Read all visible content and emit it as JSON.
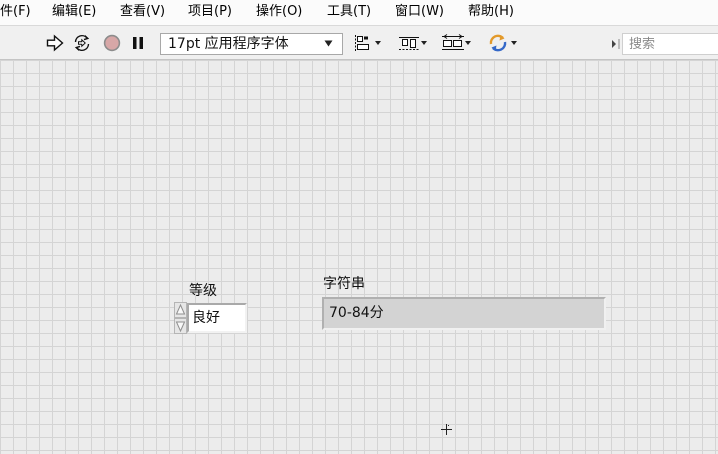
{
  "window": {
    "menu": [
      "件(F)",
      "编辑(E)",
      "查看(V)",
      "项目(P)",
      "操作(O)",
      "工具(T)",
      "窗口(W)",
      "帮助(H)"
    ]
  },
  "toolbar": {
    "run_icons": [
      "run-arrow-icon",
      "run-continuously-icon",
      "abort-execution-icon",
      "pause-icon"
    ],
    "font_select": "17pt 应用程序字体",
    "layout_icons": [
      "align-objects-icon",
      "distribute-objects-icon",
      "resize-objects-icon",
      "reorder-objects-icon"
    ],
    "search_placeholder": "搜索"
  },
  "front_panel": {
    "grade_enum": {
      "label": "等级",
      "value": "良好"
    },
    "string_indicator": {
      "label": "字符串",
      "value": "70-84分"
    }
  },
  "colors": {
    "panel_background": "#ececec",
    "grid_line": "#d4d4d4",
    "abort_fill": "#d7a7a7",
    "indicator_fill": "#d3d3d3"
  }
}
